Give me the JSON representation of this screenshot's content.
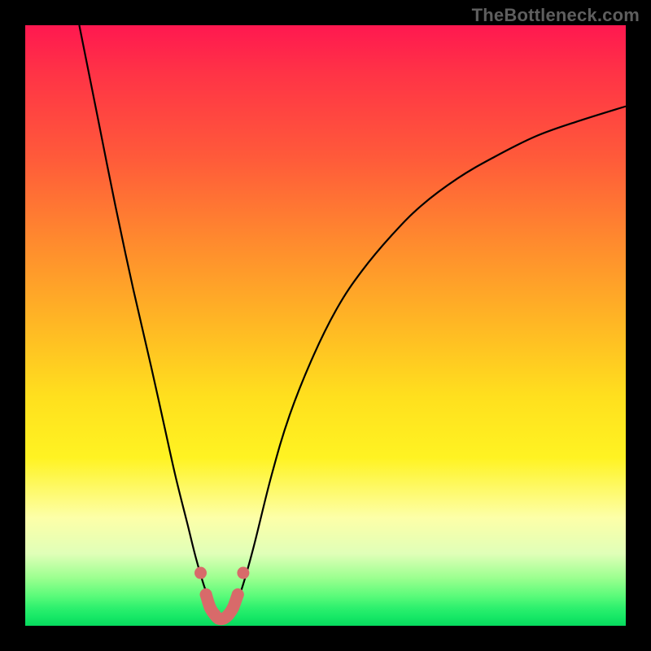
{
  "watermark": "TheBottleneck.com",
  "colors": {
    "page_bg": "#000000",
    "gradient_top": "#ff1850",
    "gradient_bottom": "#07d95e",
    "curve": "#000000",
    "marker": "#d86a6a",
    "watermark": "#5e5e5e"
  },
  "chart_data": {
    "type": "line",
    "title": "",
    "xlabel": "",
    "ylabel": "",
    "xlim": [
      0,
      100
    ],
    "ylim": [
      0,
      100
    ],
    "annotations": [
      "TheBottleneck.com"
    ],
    "legend": [],
    "grid": false,
    "series": [
      {
        "name": "bottleneck-curve",
        "x": [
          9,
          12,
          15,
          18,
          21,
          23,
          25,
          27,
          28.5,
          30,
          31.5,
          33,
          34.5,
          36,
          38,
          41,
          44,
          48,
          52,
          56,
          61,
          66,
          72,
          78,
          85,
          92,
          100
        ],
        "values": [
          100,
          85,
          70,
          56,
          43,
          34,
          25,
          17,
          11,
          6,
          2.5,
          1,
          2.5,
          6,
          13,
          25,
          35,
          45,
          53,
          59,
          65,
          70,
          74.5,
          78,
          81.5,
          84,
          86.5
        ]
      },
      {
        "name": "optimal-markers",
        "x": [
          29.2,
          30.1,
          30.8,
          31.6,
          32.2,
          33.0,
          33.8,
          34.6,
          35.4,
          36.3
        ],
        "values": [
          8.8,
          5.2,
          3.0,
          1.8,
          1.2,
          1.2,
          1.8,
          3.0,
          5.2,
          8.8
        ]
      }
    ]
  }
}
